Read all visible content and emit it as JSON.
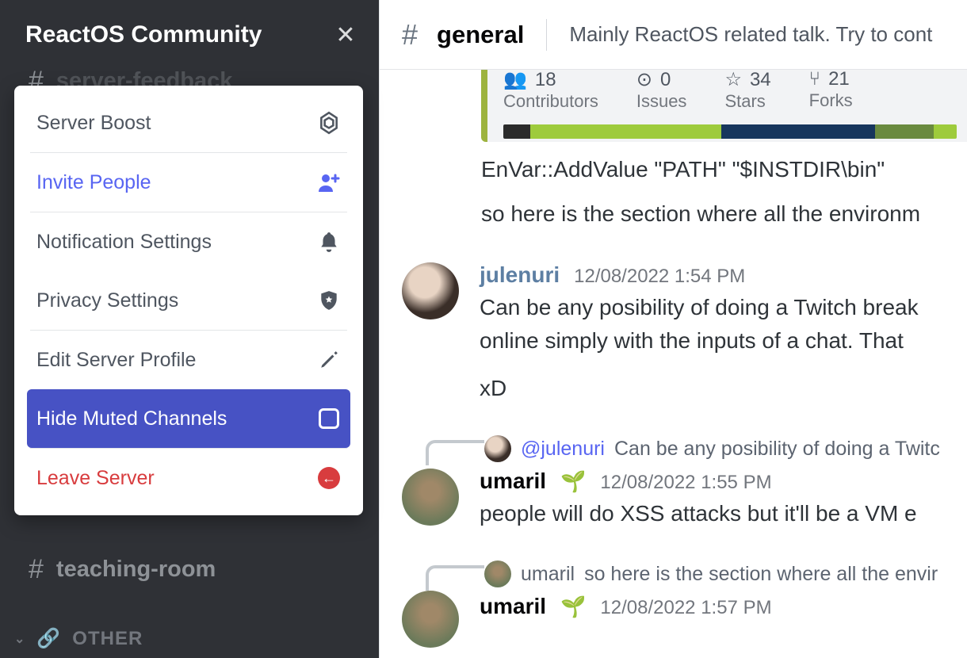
{
  "server": {
    "name": "ReactOS Community"
  },
  "menu": {
    "boost": "Server Boost",
    "invite": "Invite People",
    "notifications": "Notification Settings",
    "privacy": "Privacy Settings",
    "edit_profile": "Edit Server Profile",
    "hide_muted": "Hide Muted Channels",
    "leave": "Leave Server"
  },
  "channels": {
    "partial_top": "server-feedback",
    "teaching": "teaching-room",
    "other_label": "OTHER"
  },
  "header": {
    "channel": "general",
    "topic": "Mainly ReactOS related talk. Try to cont"
  },
  "embed": {
    "stats": [
      {
        "value": "18",
        "label": "Contributors"
      },
      {
        "value": "0",
        "label": "Issues"
      },
      {
        "value": "34",
        "label": "Stars"
      },
      {
        "value": "21",
        "label": "Forks"
      }
    ],
    "lang_segments": [
      {
        "color": "#2b2b2b",
        "pct": 6
      },
      {
        "color": "#9ecb3c",
        "pct": 42
      },
      {
        "color": "#17365d",
        "pct": 34
      },
      {
        "color": "#6a8a3f",
        "pct": 13
      },
      {
        "color": "#9ecb3c",
        "pct": 5
      }
    ]
  },
  "messages": {
    "code_line": "EnVar::AddValue \"PATH\" \"$INSTDIR\\bin\"",
    "followup": "so here is the section where all the environm",
    "m1": {
      "author": "julenuri",
      "time": "12/08/2022 1:54 PM",
      "line1": "Can be any posibility of doing a Twitch break",
      "line2": "online simply with the inputs of a chat. That",
      "line3": "xD"
    },
    "reply1": {
      "mention": "@julenuri",
      "text": "Can be any posibility of doing a Twitc"
    },
    "m2": {
      "author": "umaril",
      "time": "12/08/2022 1:55 PM",
      "line1": "people will do XSS attacks but it'll be a VM e"
    },
    "reply2": {
      "author_ref": "umaril",
      "text": "so here is the section where all the envir"
    },
    "m3": {
      "author": "umaril",
      "time": "12/08/2022 1:57 PM"
    }
  }
}
